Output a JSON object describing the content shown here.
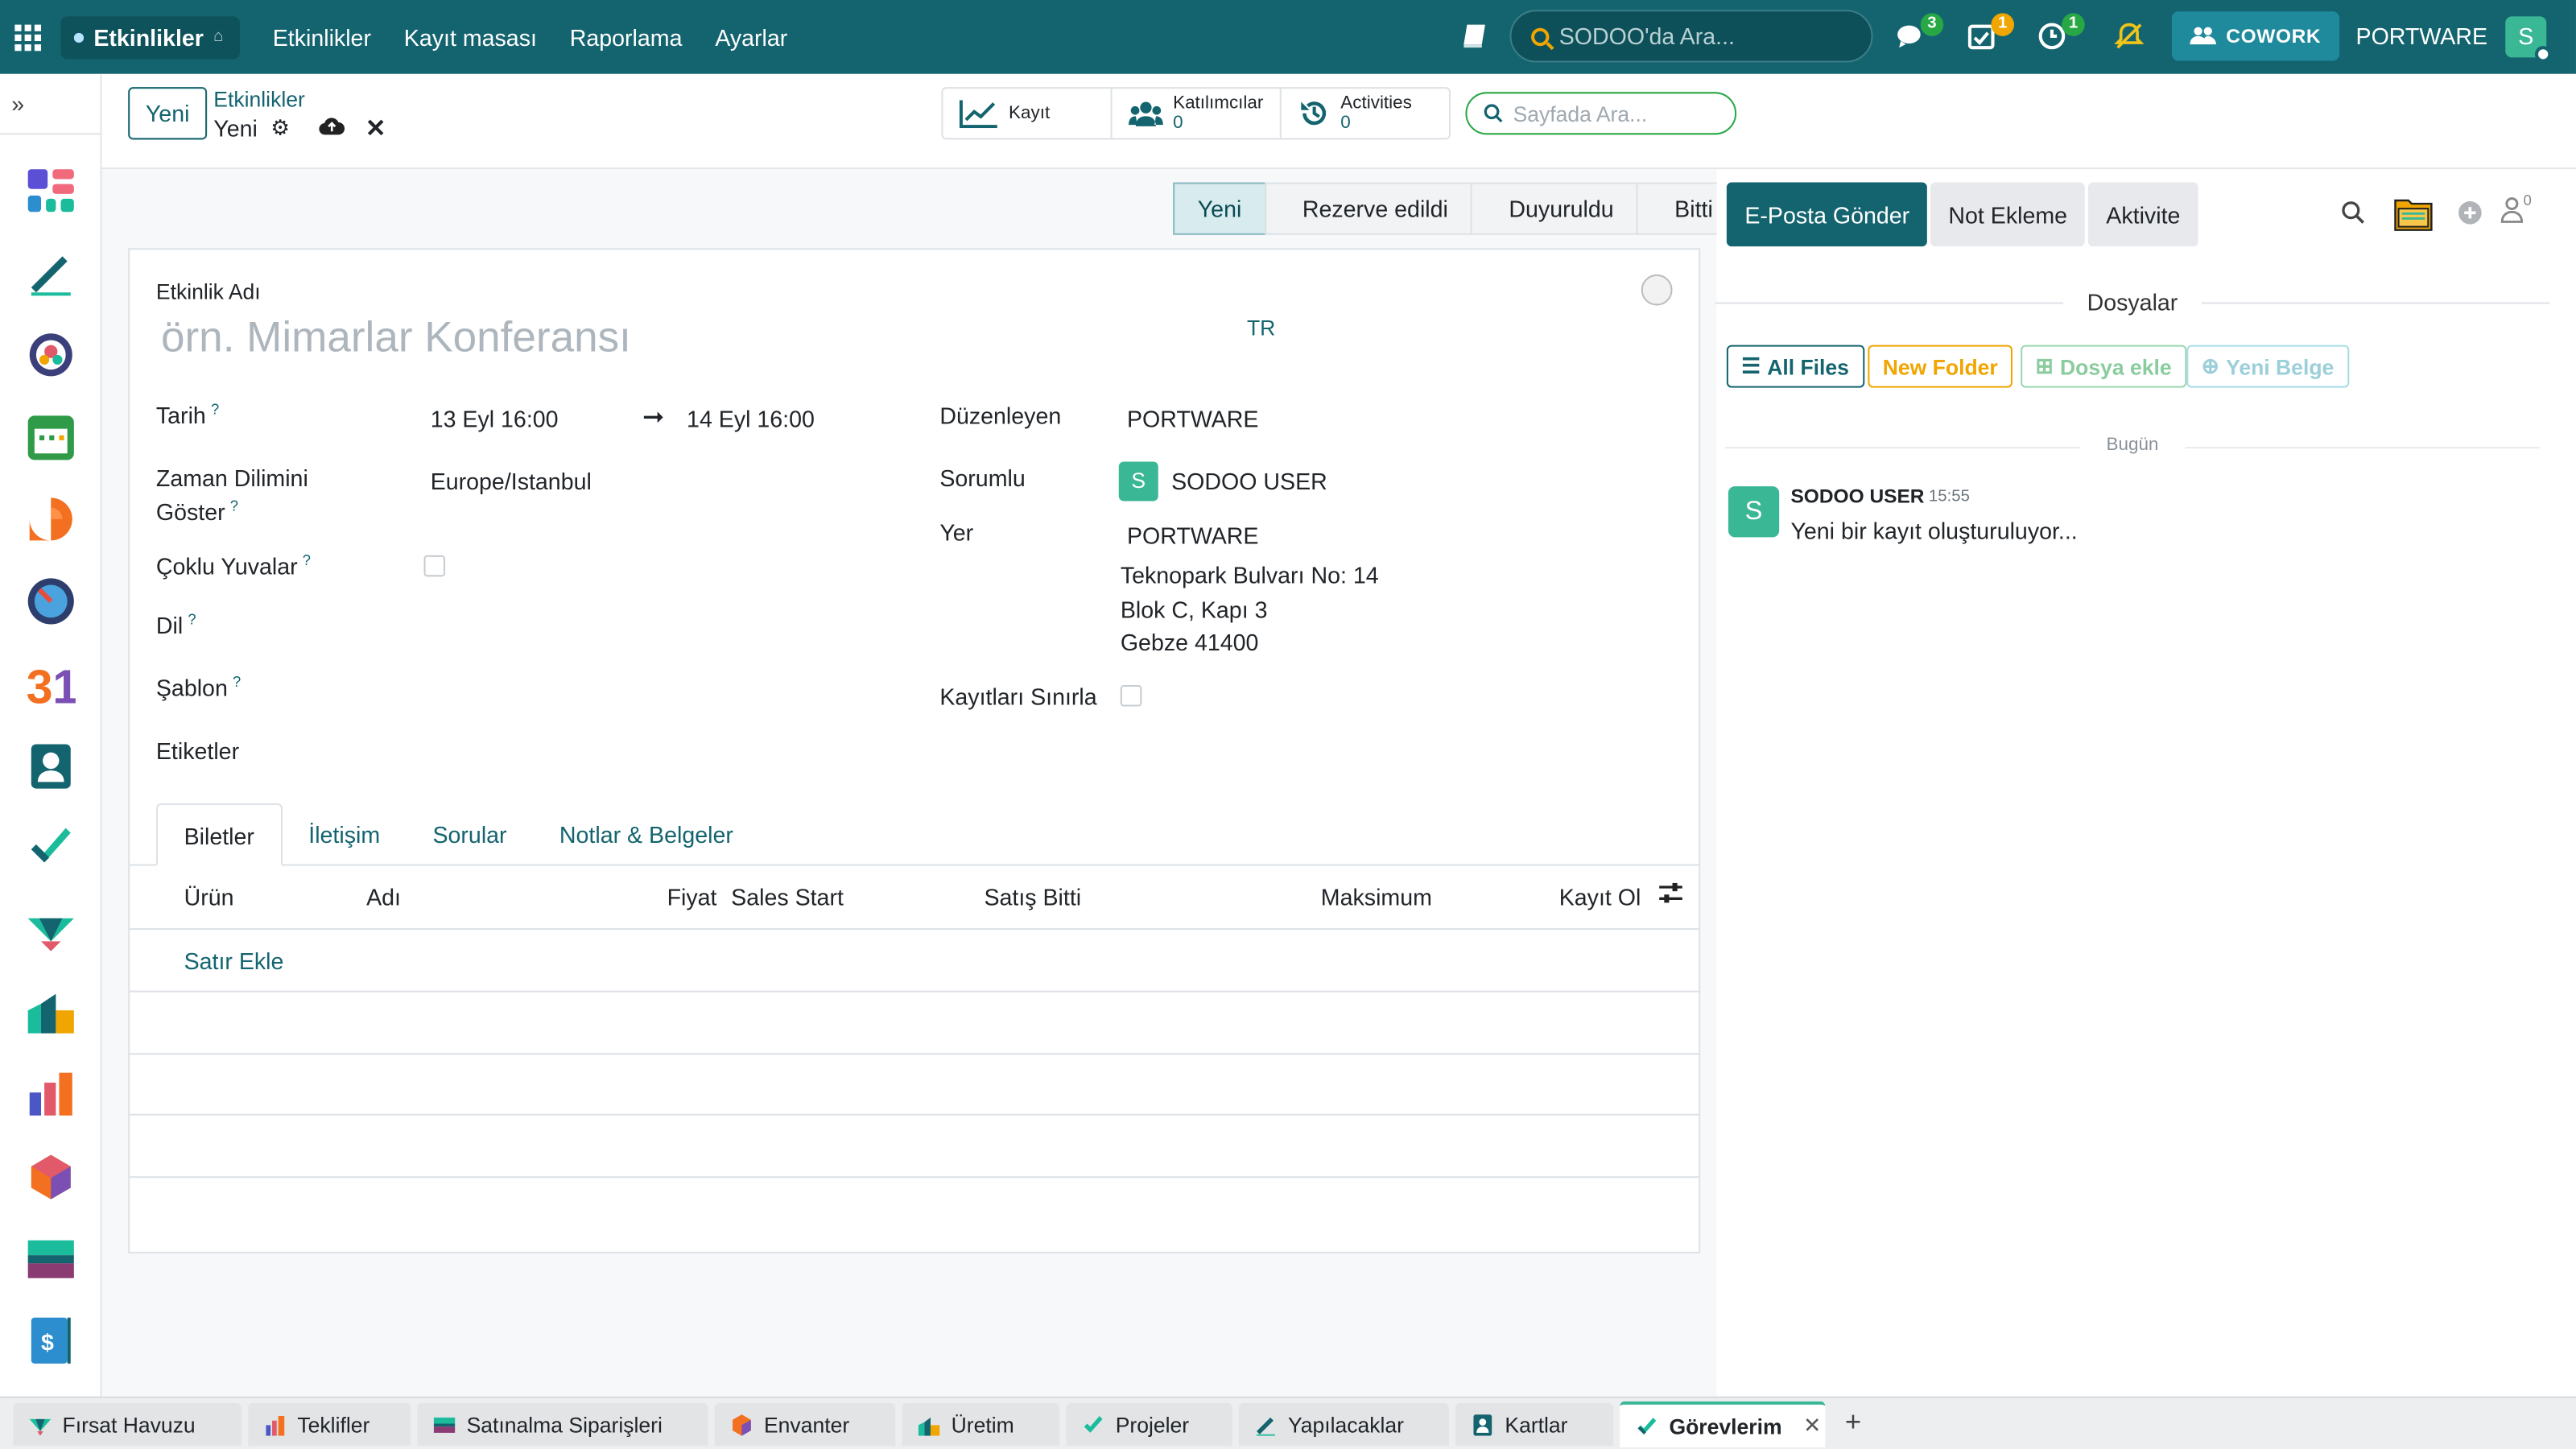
{
  "navbar": {
    "app_name": "Etkinlikler",
    "menu": [
      "Etkinlikler",
      "Kayıt masası",
      "Raporlama",
      "Ayarlar"
    ],
    "search_placeholder": "SODOO'da Ara...",
    "badges": {
      "messages": "3",
      "activities": "1",
      "timer": "1"
    },
    "cowork_label": "COWORK",
    "company": "PORTWARE",
    "user_initial": "S",
    "color": "#14646f"
  },
  "control_panel": {
    "new_button": "Yeni",
    "breadcrumb_parent": "Etkinlikler",
    "breadcrumb_current": "Yeni",
    "stat_buttons": [
      {
        "label": "Kayıt",
        "value": "",
        "icon": "chart-line-icon"
      },
      {
        "label": "Katılımcılar",
        "value": "0",
        "icon": "users-icon"
      },
      {
        "label": "Activities",
        "value": "0",
        "icon": "history-icon"
      }
    ],
    "page_search_placeholder": "Sayfada Ara..."
  },
  "statusbar": [
    "Yeni",
    "Rezerve edildi",
    "Duyuruldu",
    "Bitti"
  ],
  "form": {
    "event_name_label": "Etkinlik Adı",
    "event_name_placeholder": "örn. Mimarlar Konferansı",
    "lang_code": "TR",
    "fields_left": {
      "date_label": "Tarih",
      "date_begin": "13 Eyl 16:00",
      "date_end": "14 Eyl 16:00",
      "tz_label_1": "Zaman Dilimini",
      "tz_label_2": "Göster",
      "tz_value": "Europe/Istanbul",
      "multi_slots_label": "Çoklu Yuvalar",
      "language_label": "Dil",
      "template_label": "Şablon",
      "tags_label": "Etiketler"
    },
    "fields_right": {
      "organizer_label": "Düzenleyen",
      "organizer_value": "PORTWARE",
      "responsible_label": "Sorumlu",
      "responsible_initial": "S",
      "responsible_value": "SODOO USER",
      "venue_label": "Yer",
      "venue_name": "PORTWARE",
      "venue_line1": "Teknopark Bulvarı No: 14",
      "venue_line2": "Blok C, Kapı 3",
      "venue_line3": "Gebze 41400",
      "limit_label": "Kayıtları Sınırla"
    },
    "tabs": [
      "Biletler",
      "İletişim",
      "Sorular",
      "Notlar & Belgeler"
    ],
    "ticket_columns": [
      "Ürün",
      "Adı",
      "Fiyat",
      "Sales Start",
      "Satış Bitti",
      "Maksimum",
      "Kayıt Ol"
    ],
    "add_line": "Satır Ekle"
  },
  "chatter": {
    "send_email": "E-Posta Gönder",
    "log_note": "Not Ekleme",
    "activity": "Aktivite",
    "followers_count": "0",
    "files_title": "Dosyalar",
    "file_buttons": {
      "all_files": "All Files",
      "new_folder": "New Folder",
      "add_file": "Dosya ekle",
      "new_doc": "Yeni Belge"
    },
    "today_label": "Bugün",
    "message": {
      "author_initial": "S",
      "author": "SODOO USER",
      "time": "15:55",
      "body": "Yeni bir kayıt oluşturuluyor..."
    }
  },
  "bottom_tabs": [
    "Fırsat Havuzu",
    "Teklifler",
    "Satınalma Siparişleri",
    "Envanter",
    "Üretim",
    "Projeler",
    "Yapılacaklar",
    "Kartlar",
    "Görevlerim"
  ]
}
